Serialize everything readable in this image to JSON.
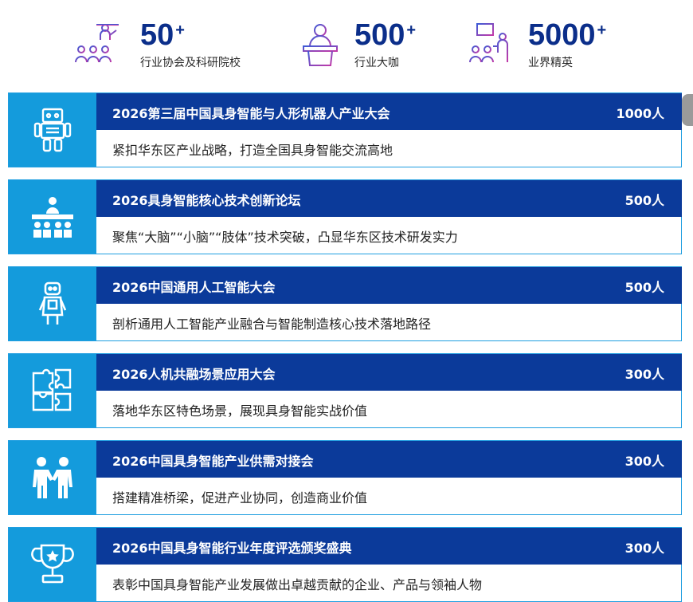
{
  "stats": [
    {
      "number": "50",
      "plus": "+",
      "label": "行业协会及科研院校",
      "icon": "audience-presenter-icon"
    },
    {
      "number": "500",
      "plus": "+",
      "label": "行业大咖",
      "icon": "speaker-podium-icon"
    },
    {
      "number": "5000",
      "plus": "+",
      "label": "业界精英",
      "icon": "presentation-audience-icon"
    }
  ],
  "events": [
    {
      "title": "2026第三届中国具身智能与人形机器人产业大会",
      "count": "1000人",
      "desc": "紧扣华东区产业战略，打造全国具身智能交流高地",
      "icon": "robot-icon"
    },
    {
      "title": "2026具身智能核心技术创新论坛",
      "count": "500人",
      "desc": "聚焦“大脑”“小脑”“肢体”技术突破，凸显华东区技术研发实力",
      "icon": "forum-podium-icon"
    },
    {
      "title": "2026中国通用人工智能大会",
      "count": "500人",
      "desc": "剖析通用人工智能产业融合与智能制造核心技术落地路径",
      "icon": "ai-robot-icon"
    },
    {
      "title": "2026人机共融场景应用大会",
      "count": "300人",
      "desc": "落地华东区特色场景，展现具身智能实战价值",
      "icon": "puzzle-icon"
    },
    {
      "title": "2026中国具身智能产业供需对接会",
      "count": "300人",
      "desc": "搭建精准桥梁，促进产业协同，创造商业价值",
      "icon": "handshake-people-icon"
    },
    {
      "title": "2026中国具身智能行业年度评选颁奖盛典",
      "count": "300人",
      "desc": "表彰中国具身智能产业发展做出卓越贡献的企业、产品与领袖人物",
      "icon": "trophy-icon"
    }
  ],
  "colors": {
    "header_blue": "#0b3a9a",
    "side_blue": "#149bdc",
    "stat_blue": "#0b2e8a"
  }
}
